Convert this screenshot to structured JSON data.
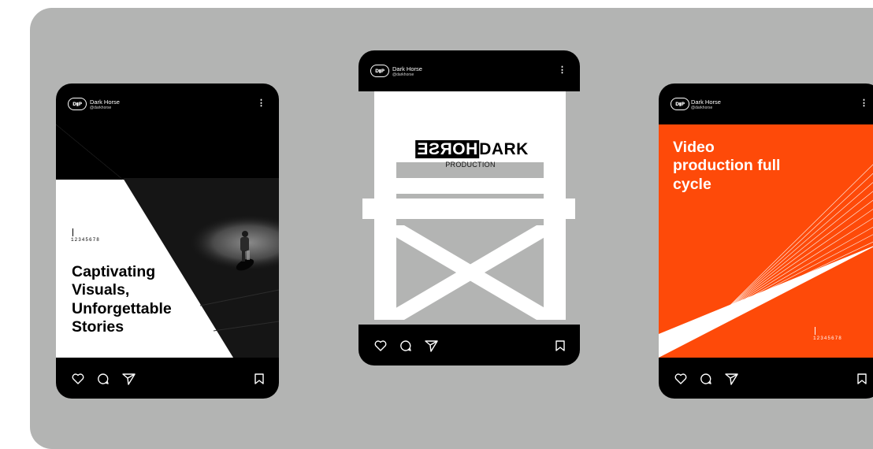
{
  "account": {
    "name": "Dark Horse",
    "handle": "@darkhorse",
    "logo_text": "D▮P"
  },
  "posts": [
    {
      "caption": "Captivating Visuals, Unforgettable Stories",
      "ruler": "12345678"
    },
    {
      "brand_mirror": "HORSE",
      "brand_word": "DARK",
      "brand_sub": "PRODUCTION"
    },
    {
      "caption": "Video production full cycle",
      "ruler": "12345678",
      "accent": "#fe4a09"
    }
  ],
  "icons": [
    "heart-icon",
    "comment-icon",
    "share-icon",
    "bookmark-icon",
    "more-icon"
  ],
  "colors": {
    "background": "#b3b4b3",
    "card": "#000000",
    "white": "#ffffff",
    "accent": "#fe4a09"
  }
}
